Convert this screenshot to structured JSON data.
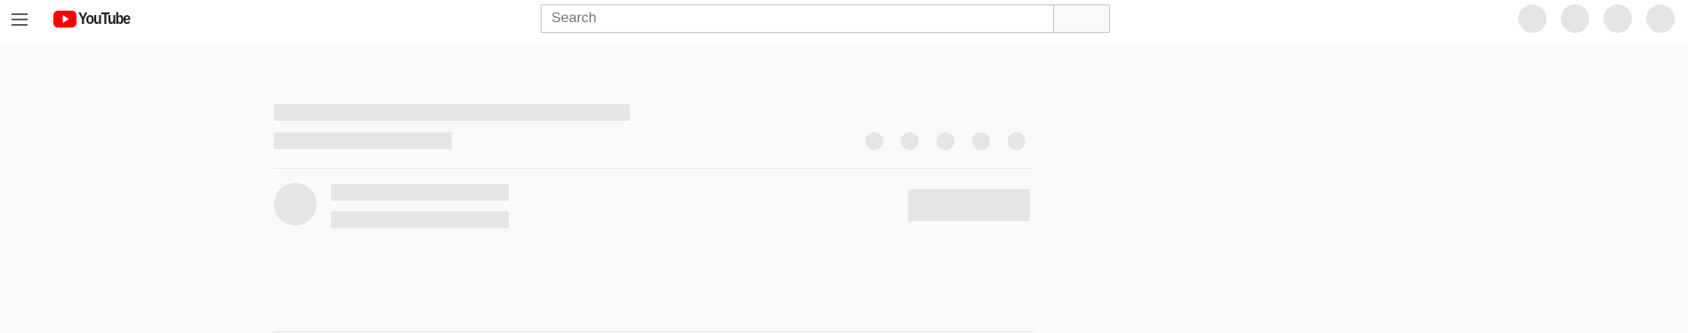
{
  "header": {
    "logo_text": "YouTube",
    "search": {
      "placeholder": "Search",
      "value": ""
    }
  },
  "colors": {
    "brand_red": "#ff0000",
    "skeleton": "#e5e5e5",
    "page_background": "#f9f9f9",
    "header_background": "#ffffff"
  },
  "icons": {
    "menu": "hamburger-menu-icon",
    "logo": "youtube-play-logo-icon"
  },
  "skeleton": {
    "state": "loading"
  }
}
